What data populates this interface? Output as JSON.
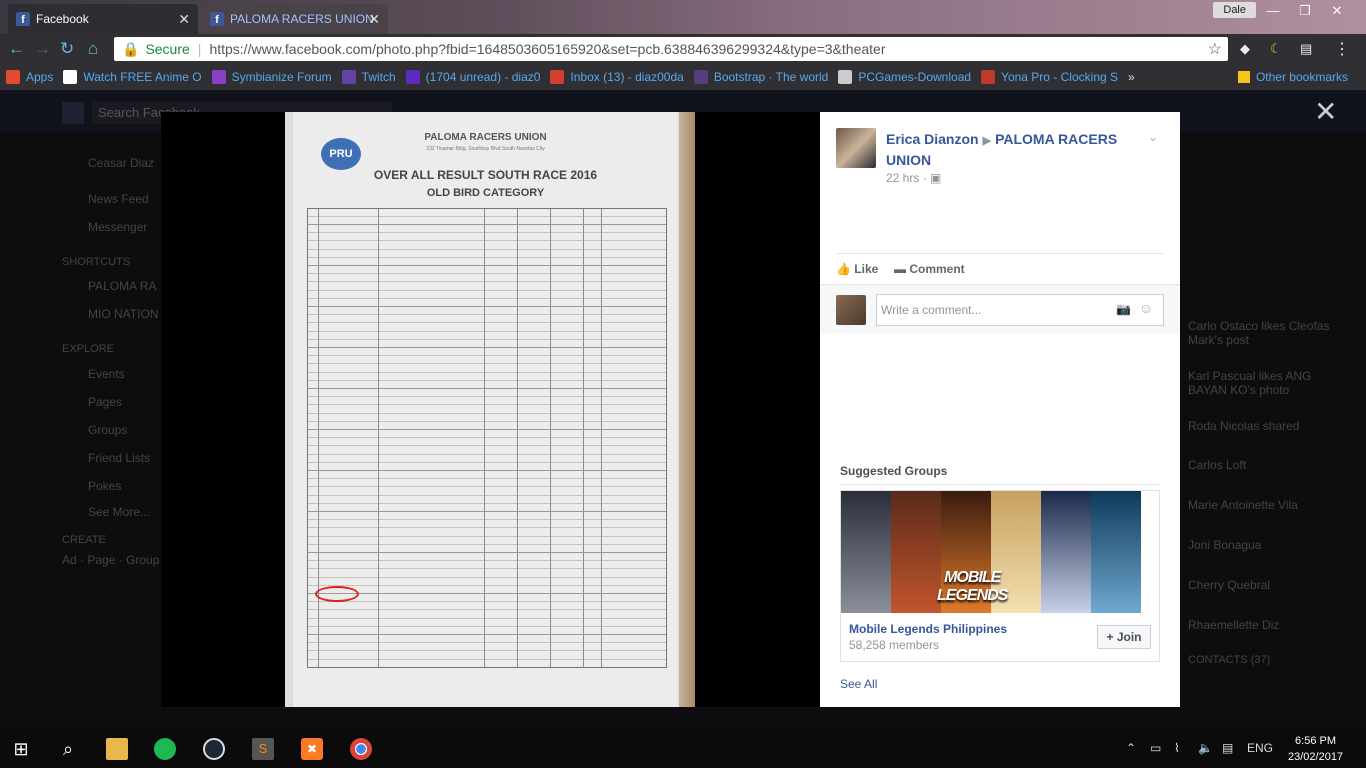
{
  "browser": {
    "tabs": [
      {
        "title": "Facebook"
      },
      {
        "title": "PALOMA RACERS UNION"
      }
    ],
    "profile": "Dale",
    "secure_label": "Secure",
    "url": "https://www.facebook.com/photo.php?fbid=1648503605165920&set=pcb.638846396299324&type=3&theater",
    "bookmarks": [
      {
        "label": "Apps",
        "icon": "apps-grid-icon",
        "color": "#e04a2f"
      },
      {
        "label": "Watch FREE Anime O",
        "icon": "anime-site-icon",
        "color": "#ffffff"
      },
      {
        "label": "Symbianize Forum",
        "icon": "symbianize-icon",
        "color": "#8a3fc7"
      },
      {
        "label": "Twitch",
        "icon": "twitch-icon",
        "color": "#6441a5"
      },
      {
        "label": "(1704 unread) - diaz0",
        "icon": "yahoo-mail-icon",
        "color": "#5f2bbf"
      },
      {
        "label": "Inbox (13) - diaz00da",
        "icon": "gmail-icon",
        "color": "#d23f31"
      },
      {
        "label": "Bootstrap · The world",
        "icon": "bootstrap-icon",
        "color": "#563d7c"
      },
      {
        "label": "PCGames-Download",
        "icon": "pcgames-icon",
        "color": "#cccccc"
      },
      {
        "label": "Yona Pro - Clocking S",
        "icon": "yona-icon",
        "color": "#c0392b"
      }
    ],
    "overflow": "»",
    "other_bookmarks": "Other bookmarks"
  },
  "facebook_bg": {
    "search_placeholder": "Search Facebook",
    "user_name": "Ceasar Diaz",
    "left_menu": [
      "News Feed",
      "Messenger",
      "SHORTCUTS",
      "PALOMA RA",
      "MIO NATION",
      "EXPLORE",
      "Events",
      "Pages",
      "Groups",
      "Friend Lists",
      "Pokes",
      "See More...",
      "CREATE",
      "Ad · Page · Group"
    ],
    "right_feed": [
      "Carlo Ostaco likes Cleofas Mark's post",
      "Karl Pascual likes ANG BAYAN KO's photo",
      "Roda Nicolas shared",
      "Carlos Loft",
      "Marie Antoinette Vila",
      "Joni Bonagua",
      "Cherry Quebral",
      "Rhaemellette Diz",
      "CONTACTS (37)"
    ]
  },
  "photo": {
    "org_name": "PALOMA RACERS UNION",
    "address": "232 Tinamar Bldg. Southbay Blvd South Navotas City",
    "logo_text": "PRU",
    "title_line1": "OVER ALL RESULT  SOUTH RACE 2016",
    "title_line2": "OLD BIRD CATEGORY"
  },
  "post": {
    "author": "Erica Dianzon",
    "group": "PALOMA RACERS UNION",
    "time": "22 hrs",
    "like_label": "Like",
    "comment_label": "Comment",
    "comment_placeholder": "Write a comment..."
  },
  "suggested_groups": {
    "title": "Suggested Groups",
    "group_name": "Mobile Legends Philippines",
    "members": "58,258 members",
    "join_label": "+ Join",
    "logo_line1": "MOBILE",
    "logo_line2": "LEGENDS",
    "see_all": "See All"
  },
  "taskbar": {
    "language": "ENG",
    "time": "6:56 PM",
    "date": "23/02/2017"
  },
  "colors": {
    "fb_blue": "#365899",
    "secure_green": "#1a8a3a",
    "highlight_red": "#dd2222"
  }
}
